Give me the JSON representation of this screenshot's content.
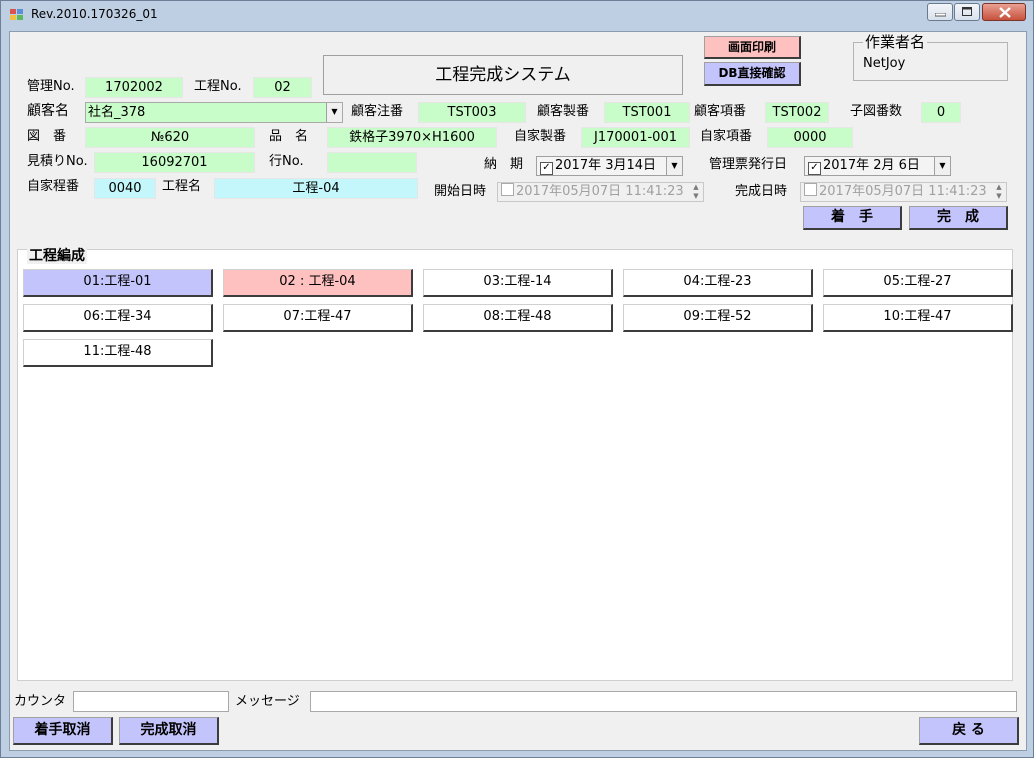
{
  "window": {
    "title": "Rev.2010.170326_01"
  },
  "icons": {
    "app": "app-grid-icon",
    "minimize": "minimize-icon",
    "maximize": "maximize-icon",
    "close": "close-icon"
  },
  "colors": {
    "field_green": "#c8fcc8",
    "field_cyan": "#c4f7fb",
    "button_blue": "#c4c4fc",
    "button_pink": "#ffc0c0"
  },
  "header": {
    "kanri_no_label": "管理No.",
    "kanri_no_value": "1702002",
    "koutei_no_label": "工程No.",
    "koutei_no_value": "02",
    "system_title": "工程完成システム",
    "print_button": "画面印刷",
    "db_button": "DB直接確認",
    "worker_label": "作業者名",
    "worker_value": "NetJoy"
  },
  "row2": {
    "customer_label": "顧客名",
    "customer_value": "社名_378",
    "cust_order_label": "顧客注番",
    "cust_order_value": "TST003",
    "cust_product_label": "顧客製番",
    "cust_product_value": "TST001",
    "cust_item_label": "顧客項番",
    "cust_item_value": "TST002",
    "child_count_label": "子図番数",
    "child_count_value": "0"
  },
  "row3": {
    "drawing_label": "図　番",
    "drawing_value": "№620",
    "product_label": "品　名",
    "product_value": "鉄格子3970×H1600",
    "own_product_label": "自家製番",
    "own_product_value": "J170001-001",
    "own_item_label": "自家項番",
    "own_item_value": "0000"
  },
  "row4": {
    "estimate_label": "見積りNo.",
    "estimate_value": "16092701",
    "line_label": "行No.",
    "line_value": "",
    "delivery_label": "納　期",
    "delivery_value": "2017年  3月14日",
    "ticket_label": "管理票発行日",
    "ticket_value": "2017年  2月  6日"
  },
  "row5": {
    "own_process_label": "自家程番",
    "own_process_value": "0040",
    "process_name_label": "工程名",
    "process_name_value": "工程-04",
    "start_label": "開始日時",
    "start_value": "2017年05月07日 11:41:23",
    "end_label": "完成日時",
    "end_value": "2017年05月07日 11:41:23"
  },
  "actions": {
    "start_button": "着　手",
    "complete_button": "完　成"
  },
  "process_group": {
    "legend": "工程編成",
    "items": [
      {
        "label": "01:工程-01",
        "state": "done"
      },
      {
        "label": "02 : 工程-04",
        "state": "current"
      },
      {
        "label": "03:工程-14",
        "state": "pending"
      },
      {
        "label": "04:工程-23",
        "state": "pending"
      },
      {
        "label": "05:工程-27",
        "state": "pending"
      },
      {
        "label": "06:工程-34",
        "state": "pending"
      },
      {
        "label": "07:工程-47",
        "state": "pending"
      },
      {
        "label": "08:工程-48",
        "state": "pending"
      },
      {
        "label": "09:工程-52",
        "state": "pending"
      },
      {
        "label": "10:工程-47",
        "state": "pending"
      },
      {
        "label": "11:工程-48",
        "state": "pending"
      }
    ]
  },
  "footer": {
    "counter_label": "カウンタ",
    "counter_value": "",
    "message_label": "メッセージ",
    "message_value": "",
    "cancel_start_button": "着手取消",
    "cancel_complete_button": "完成取消",
    "back_button": "戻 る"
  }
}
